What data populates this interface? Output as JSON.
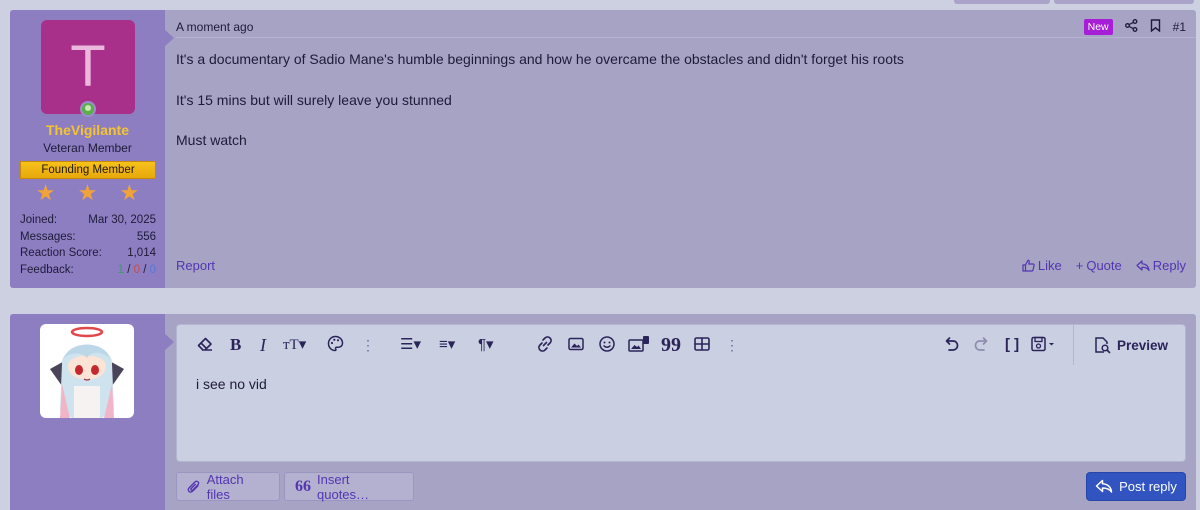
{
  "post": {
    "user": {
      "avatar_letter": "T",
      "username": "TheVigilante",
      "title": "Veteran Member",
      "banner": "Founding Member",
      "stars": "★ ★ ★",
      "stats": [
        {
          "label": "Joined:",
          "value": "Mar 30, 2025"
        },
        {
          "label": "Messages:",
          "value": "556"
        },
        {
          "label": "Reaction Score:",
          "value": "1,014"
        }
      ],
      "feedback_label": "Feedback:",
      "feedback": {
        "positive": "1",
        "neutral": "0",
        "negative": "0",
        "separator": " / "
      }
    },
    "time": "A moment ago",
    "new_badge": "New",
    "number": "#1",
    "body": [
      "It's a documentary of Sadio Mane's humble beginnings and how he overcame the obstacles and didn't forget his roots",
      "It's 15 mins but will surely leave you stunned",
      "Must watch"
    ],
    "footer": {
      "report": "Report",
      "like": "Like",
      "quote": "Quote",
      "reply": "Reply"
    }
  },
  "reply_form": {
    "editor_text": "i see no vid",
    "preview": "Preview",
    "attach_files": "Attach files",
    "insert_quotes": "Insert quotes…",
    "post_reply": "Post reply"
  },
  "colors": {
    "page_bg": "#cdd0e0",
    "post_bg": "#a6a3c5",
    "user_cell_bg": "#8d7ec2",
    "username": "#f4c430",
    "link": "#5336b0",
    "new_badge": "#a61fd6",
    "primary_button": "#3154c0"
  },
  "icons": {
    "toolbar": [
      "eraser-icon",
      "bold-icon",
      "italic-icon",
      "text-size-icon",
      "palette-icon",
      "more-vertical-icon",
      "list-icon",
      "align-icon",
      "paragraph-icon",
      "link-icon",
      "image-icon",
      "smiley-icon",
      "media-icon",
      "quote-icon",
      "table-icon",
      "more-vertical-icon",
      "undo-icon",
      "redo-icon",
      "bbcode-icon",
      "drafts-icon"
    ]
  }
}
